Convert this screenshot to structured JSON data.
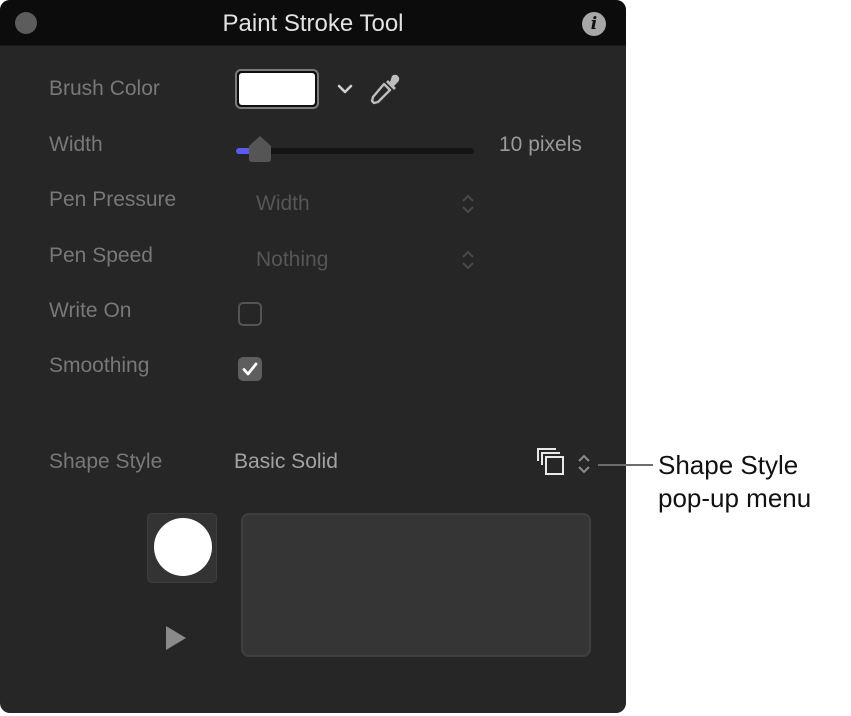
{
  "window": {
    "title": "Paint Stroke Tool",
    "close_icon": "circle-close-icon",
    "info_icon": "info-icon",
    "info_glyph": "i"
  },
  "fields": {
    "brush_color": {
      "label": "Brush Color",
      "color": "#ffffff",
      "menu_icon": "chevron-down-icon",
      "picker_icon": "eyedropper-icon"
    },
    "width": {
      "label": "Width",
      "value_text": "10 pixels",
      "slider_fraction": 0.1,
      "accent": "#5a5cf0"
    },
    "pen_pressure": {
      "label": "Pen Pressure",
      "value": "Width"
    },
    "pen_speed": {
      "label": "Pen Speed",
      "value": "Nothing"
    },
    "write_on": {
      "label": "Write On",
      "checked": false
    },
    "smoothing": {
      "label": "Smoothing",
      "checked": true,
      "check_glyph": "✓"
    },
    "shape_style": {
      "label": "Shape Style",
      "value": "Basic Solid",
      "icon": "shape-library-icon"
    }
  },
  "preview": {
    "thumbnail_icon": "brush-circle-icon",
    "play_icon": "play-icon"
  },
  "callout": {
    "line1": "Shape Style",
    "line2": "pop-up menu"
  }
}
